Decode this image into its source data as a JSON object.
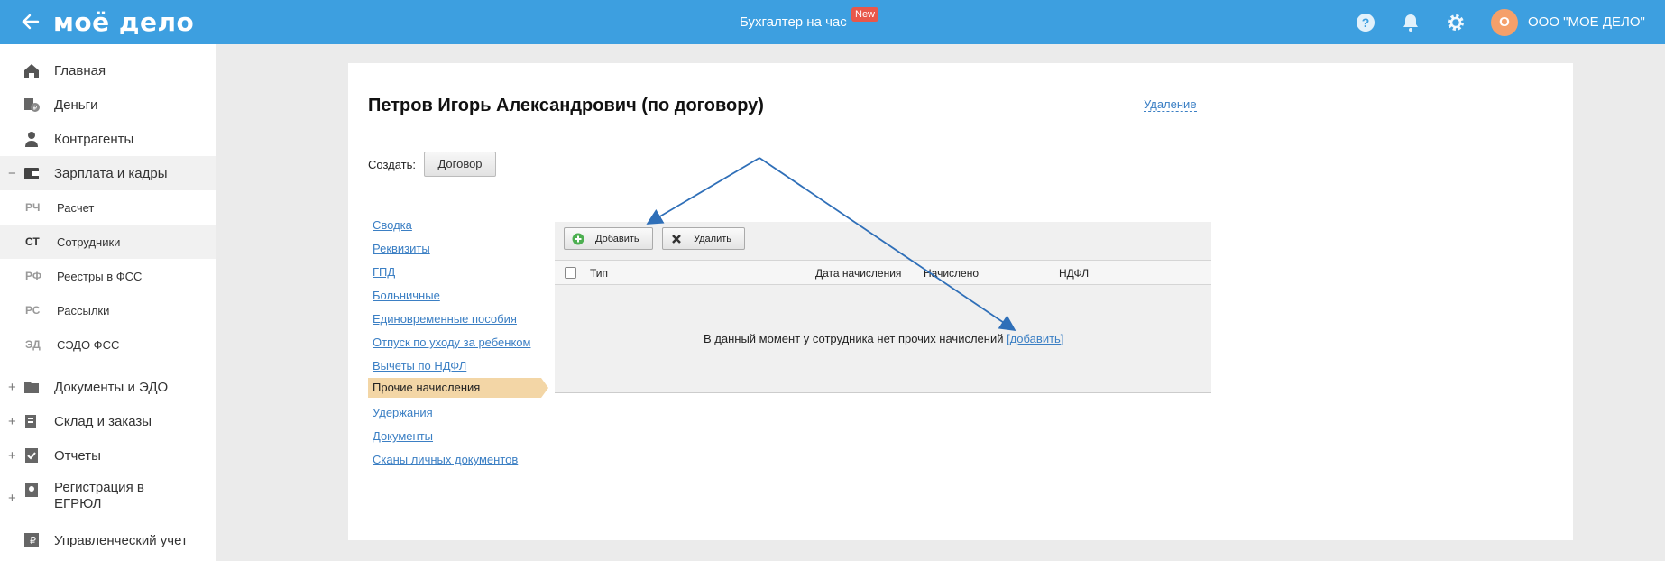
{
  "header": {
    "logo": "моё дело",
    "center_link": "Бухгалтер на час",
    "new_badge": "New",
    "avatar_letter": "О",
    "company": "ООО \"МОЕ ДЕЛО\""
  },
  "sidebar": {
    "items": [
      {
        "label": "Главная",
        "icon": "home-icon"
      },
      {
        "label": "Деньги",
        "icon": "money-icon"
      },
      {
        "label": "Контрагенты",
        "icon": "contractors-icon"
      },
      {
        "label": "Зарплата и кадры",
        "icon": "wallet-icon",
        "expander": "−"
      },
      {
        "label": "Документы и ЭДО",
        "icon": "folder-icon",
        "expander": "+"
      },
      {
        "label": "Склад и заказы",
        "icon": "warehouse-icon",
        "expander": "+"
      },
      {
        "label": "Отчеты",
        "icon": "report-icon",
        "expander": "+"
      },
      {
        "label": "Регистрация в",
        "label2": "ЕГРЮЛ",
        "icon": "registration-icon",
        "expander": "+"
      },
      {
        "label": "Управленческий учет",
        "icon": "management-icon"
      }
    ],
    "subitems": [
      {
        "abbr": "РЧ",
        "label": "Расчет"
      },
      {
        "abbr": "СТ",
        "label": "Сотрудники"
      },
      {
        "abbr": "РФ",
        "label": "Реестры в ФСС"
      },
      {
        "abbr": "РС",
        "label": "Рассылки"
      },
      {
        "abbr": "ЭД",
        "label": "СЭДО ФСС"
      }
    ]
  },
  "main": {
    "title": "Петров Игорь Александрович (по договору)",
    "delete_link": "Удаление",
    "create_label": "Создать:",
    "create_button": "Договор",
    "tabs": [
      "Сводка",
      "Реквизиты",
      "ГПД",
      "Больничные",
      "Единовременные пособия",
      "Отпуск по уходу за ребенком",
      "Вычеты по НДФЛ",
      "Прочие начисления",
      "Удержания",
      "Документы",
      "Сканы личных документов"
    ],
    "toolbar": {
      "add": "Добавить",
      "delete": "Удалить"
    },
    "columns": [
      "Тип",
      "Дата начисления",
      "Начислено",
      "НДФЛ"
    ],
    "empty_message": "В данный момент у сотрудника нет прочих начислений",
    "empty_link": "[добавить]"
  },
  "colors": {
    "header": "#3d9fe0",
    "active_tab": "#f3d6a6",
    "link": "#3b7fc4",
    "arrow": "#2f6fb8"
  }
}
